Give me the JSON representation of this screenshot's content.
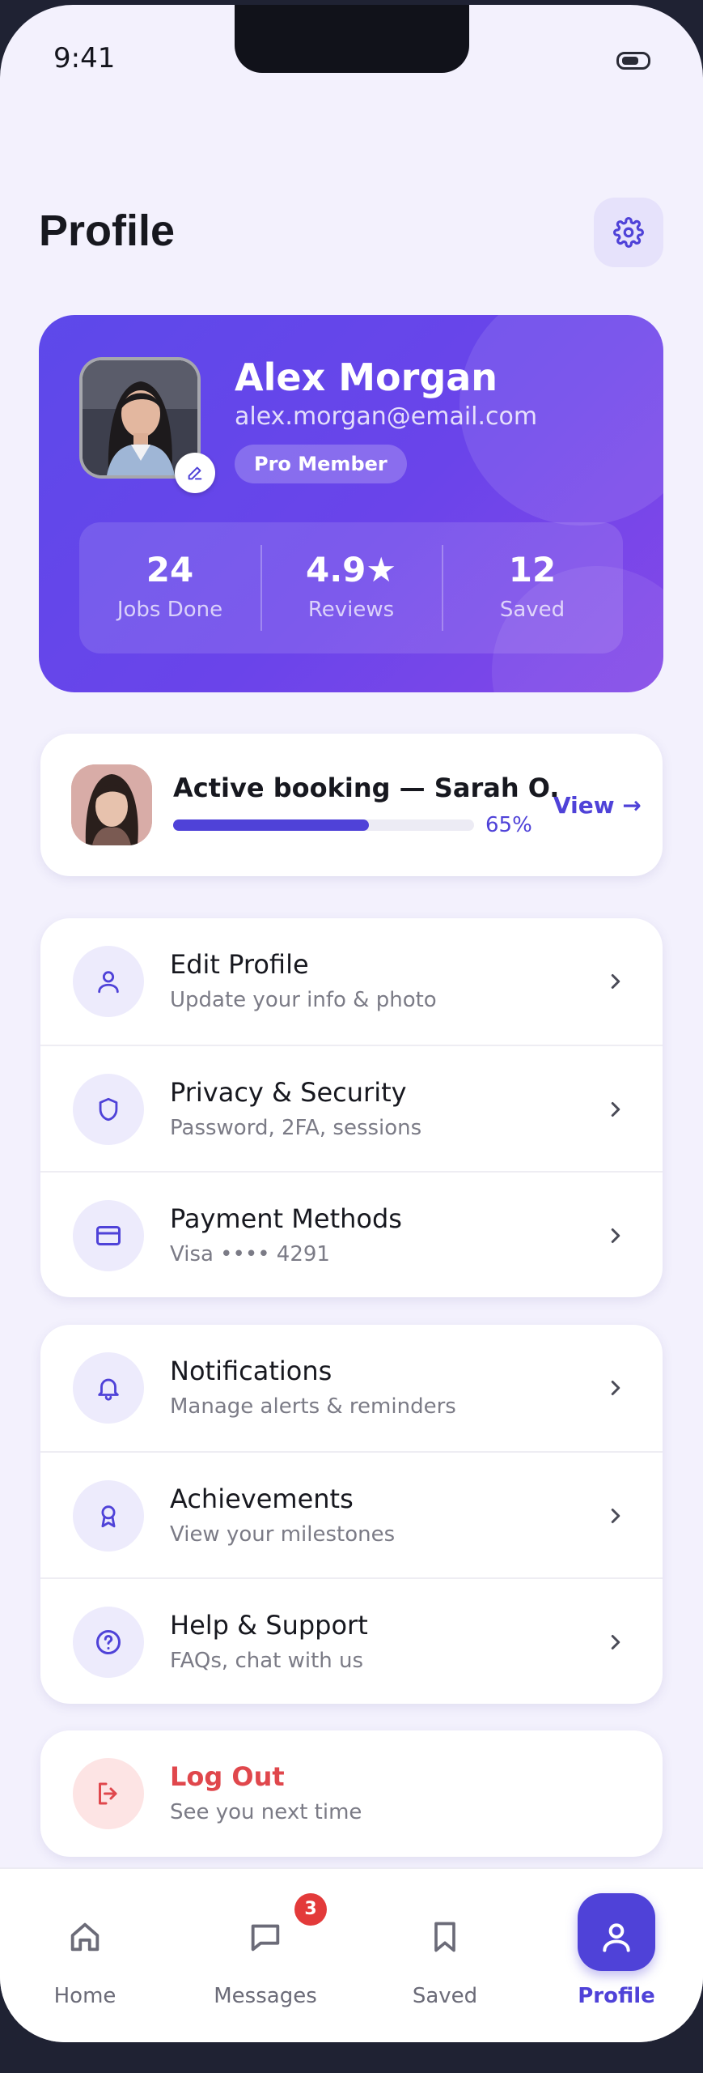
{
  "status_bar": {
    "time": "9:41"
  },
  "header": {
    "title": "Profile"
  },
  "profile": {
    "name": "Alex Morgan",
    "email": "alex.morgan@email.com",
    "membership": "Pro Member",
    "stats": [
      {
        "value": "24",
        "label": "Jobs Done"
      },
      {
        "value": "4.9★",
        "label": "Reviews"
      },
      {
        "value": "12",
        "label": "Saved"
      }
    ]
  },
  "booking": {
    "title": "Active booking — Sarah O.",
    "progress_percent": 65,
    "progress_label": "65%",
    "view_label": "View →"
  },
  "menu_group_1": [
    {
      "title": "Edit Profile",
      "subtitle": "Update your info & photo",
      "icon": "person-icon"
    },
    {
      "title": "Privacy & Security",
      "subtitle": "Password, 2FA, sessions",
      "icon": "shield-icon"
    },
    {
      "title": "Payment Methods",
      "subtitle": "Visa •••• 4291",
      "icon": "credit-card-icon"
    }
  ],
  "menu_group_2": [
    {
      "title": "Notifications",
      "subtitle": "Manage alerts & reminders",
      "icon": "bell-icon"
    },
    {
      "title": "Achievements",
      "subtitle": "View your milestones",
      "icon": "award-icon"
    },
    {
      "title": "Help & Support",
      "subtitle": "FAQs, chat with us",
      "icon": "help-circle-icon"
    }
  ],
  "logout": {
    "title": "Log Out",
    "subtitle": "See you next time",
    "icon": "logout-icon"
  },
  "tabbar": {
    "items": [
      {
        "label": "Home",
        "icon": "home-icon"
      },
      {
        "label": "Messages",
        "icon": "chat-icon",
        "badge": "3"
      },
      {
        "label": "Saved",
        "icon": "bookmark-icon"
      },
      {
        "label": "Profile",
        "icon": "user-icon",
        "active": true
      }
    ]
  },
  "colors": {
    "accent": "#4f42d8",
    "hero_gradient_start": "#5d49ea",
    "hero_gradient_end": "#8448e8",
    "danger": "#e0474c",
    "background": "#f3f1fd"
  }
}
